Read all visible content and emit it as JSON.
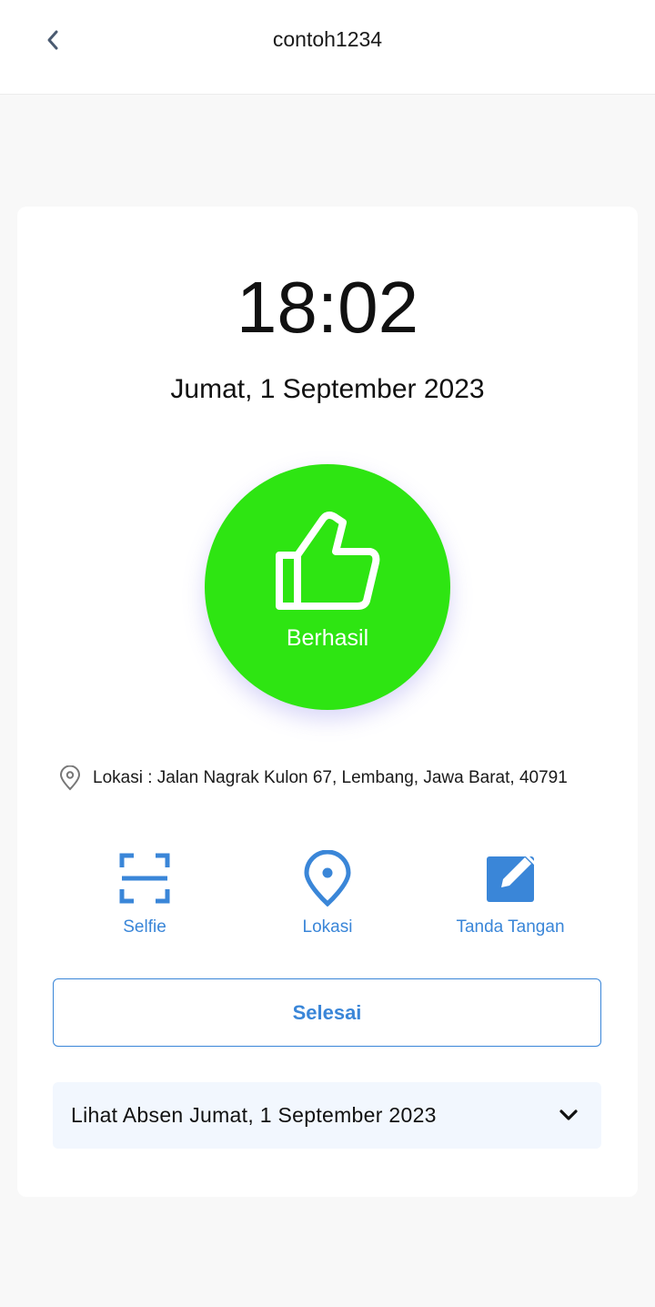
{
  "header": {
    "title": "contoh1234",
    "back_icon": "chevron-left-icon"
  },
  "clock": {
    "time": "18:02",
    "date": "Jumat, 1 September 2023"
  },
  "status": {
    "label": "Berhasil",
    "icon": "thumbs-up-icon",
    "color": "#2ee512"
  },
  "location": {
    "icon": "map-pin-outline-icon",
    "text": "Lokasi : Jalan Nagrak Kulon 67, Lembang, Jawa Barat, 40791"
  },
  "actions": [
    {
      "label": "Selfie",
      "icon": "scan-frame-icon"
    },
    {
      "label": "Lokasi",
      "icon": "map-pin-icon"
    },
    {
      "label": "Tanda Tangan",
      "icon": "edit-square-icon"
    }
  ],
  "finish_button": {
    "label": "Selesai"
  },
  "view_attendance": {
    "label": "Lihat Absen Jumat, 1 September 2023",
    "icon": "chevron-down-icon"
  },
  "colors": {
    "accent": "#3a86d8",
    "success": "#2ee512",
    "background": "#f8f8f8",
    "card": "#ffffff"
  }
}
